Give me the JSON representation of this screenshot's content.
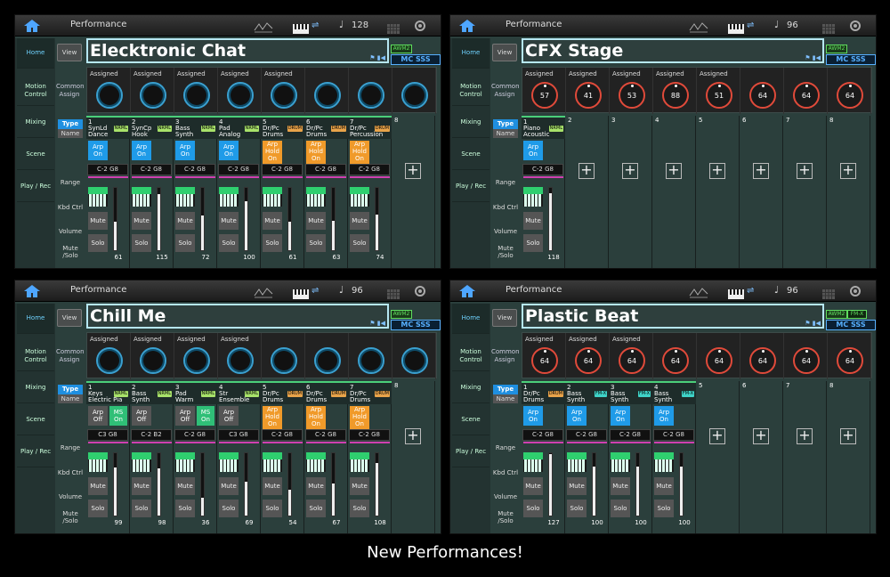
{
  "caption": "New Performances!",
  "top_bar": {
    "title": "Performance"
  },
  "sidebar": [
    "Home",
    "Motion Control",
    "Mixing",
    "Scene",
    "Play / Rec"
  ],
  "row_labels": {
    "common_assign": "Common Assign",
    "range": "Range",
    "kbd_ctrl": "Kbd Ctrl",
    "volume": "Volume",
    "mute_solo": "Mute /Solo"
  },
  "buttons": {
    "view": "View",
    "type": "Type",
    "name": "Name",
    "mute": "Mute",
    "solo": "Solo"
  },
  "screens": [
    {
      "tempo": "128",
      "name": "Elecktronic Chat",
      "badges": [
        "AWM2",
        "MC SSS"
      ],
      "knob_labels": [
        "Assigned",
        "Assigned",
        "Assigned",
        "Assigned",
        "Assigned",
        "",
        "",
        ""
      ],
      "knob_values": [
        "",
        "",
        "",
        "",
        "",
        "",
        "",
        ""
      ],
      "parts": [
        {
          "num": "1",
          "line1": "SynLd",
          "line2": "Dance",
          "tag": "NRML",
          "arp": [
            "Arp",
            "On"
          ],
          "range": "C-2  G8",
          "vol": "61",
          "fader": 0.45
        },
        {
          "num": "2",
          "line1": "SynCp",
          "line2": "Hook",
          "tag": "NRML",
          "arp": [
            "Arp",
            "On"
          ],
          "range": "C-2  G8",
          "vol": "115",
          "fader": 0.9
        },
        {
          "num": "3",
          "line1": "Bass",
          "line2": "Synth",
          "tag": "NRML",
          "arp": [
            "Arp",
            "On"
          ],
          "range": "C-2  G8",
          "vol": "72",
          "fader": 0.55
        },
        {
          "num": "4",
          "line1": "Pad",
          "line2": "Analog",
          "tag": "NRML",
          "arp": [
            "Arp",
            "On"
          ],
          "range": "C-2  G8",
          "vol": "100",
          "fader": 0.78
        },
        {
          "num": "5",
          "line1": "Dr/Pc",
          "line2": "Drums",
          "tag": "DRUM",
          "arp": [
            "Arp",
            "Hold",
            "On"
          ],
          "range": "C-2  G8",
          "vol": "61",
          "fader": 0.45
        },
        {
          "num": "6",
          "line1": "Dr/Pc",
          "line2": "Drums",
          "tag": "DRUM",
          "arp": [
            "Arp",
            "Hold",
            "On"
          ],
          "range": "C-2  G8",
          "vol": "63",
          "fader": 0.47
        },
        {
          "num": "7",
          "line1": "Dr/Pc",
          "line2": "Percussion",
          "tag": "DRUM",
          "arp": [
            "Arp",
            "Hold",
            "On"
          ],
          "range": "C-2  G8",
          "vol": "74",
          "fader": 0.57
        }
      ],
      "empty": [
        "8"
      ]
    },
    {
      "tempo": "96",
      "name": "CFX Stage",
      "badges": [
        "AWM2",
        "MC SSS"
      ],
      "knob_labels": [
        "Assigned",
        "Assigned",
        "Assigned",
        "Assigned",
        "Assigned",
        "",
        "",
        ""
      ],
      "knob_values": [
        "57",
        "41",
        "53",
        "88",
        "51",
        "64",
        "64",
        "64"
      ],
      "parts": [
        {
          "num": "1",
          "line1": "Piano",
          "line2": "Acoustic",
          "tag": "NRML",
          "arp": [
            "Arp",
            "On"
          ],
          "range": "C-2  G8",
          "vol": "118",
          "fader": 0.92
        }
      ],
      "empty": [
        "2",
        "3",
        "4",
        "5",
        "6",
        "7",
        "8"
      ]
    },
    {
      "tempo": "96",
      "name": "Chill Me",
      "badges": [
        "AWM2",
        "MC SSS"
      ],
      "knob_labels": [
        "Assigned",
        "Assigned",
        "Assigned",
        "Assigned",
        "",
        "",
        "",
        ""
      ],
      "knob_values": [
        "",
        "",
        "",
        "",
        "",
        "",
        "",
        ""
      ],
      "parts": [
        {
          "num": "1",
          "line1": "Keys",
          "line2": "Electric Pia",
          "tag": "NRML",
          "arp": [
            "Arp",
            "Off"
          ],
          "ms": [
            "MS",
            "On"
          ],
          "range": "C3  G8",
          "vol": "99",
          "fader": 0.77
        },
        {
          "num": "2",
          "line1": "Bass",
          "line2": "Synth",
          "tag": "NRML",
          "arp": [
            "Arp",
            "Off"
          ],
          "range": "C-2  B2",
          "vol": "98",
          "fader": 0.76
        },
        {
          "num": "3",
          "line1": "Pad",
          "line2": "Warm",
          "tag": "NRML",
          "arp": [
            "Arp",
            "Off"
          ],
          "ms": [
            "MS",
            "On"
          ],
          "range": "C-2  G8",
          "vol": "36",
          "fader": 0.28
        },
        {
          "num": "4",
          "line1": "Str",
          "line2": "Ensemble",
          "tag": "NRML",
          "arp": [
            "Arp",
            "Off"
          ],
          "range": "C3  G8",
          "vol": "69",
          "fader": 0.54
        },
        {
          "num": "5",
          "line1": "Dr/Pc",
          "line2": "Drums",
          "tag": "DRUM",
          "arp": [
            "Arp",
            "Hold",
            "On"
          ],
          "range": "C-2  G8",
          "vol": "54",
          "fader": 0.42
        },
        {
          "num": "6",
          "line1": "Dr/Pc",
          "line2": "Drums",
          "tag": "DRUM",
          "arp": [
            "Arp",
            "Hold",
            "On"
          ],
          "range": "C-2  G8",
          "vol": "67",
          "fader": 0.52
        },
        {
          "num": "7",
          "line1": "Dr/Pc",
          "line2": "Drums",
          "tag": "DRUM",
          "arp": [
            "Arp",
            "Hold",
            "On"
          ],
          "range": "C-2  G8",
          "vol": "108",
          "fader": 0.84
        }
      ],
      "empty": [
        "8"
      ]
    },
    {
      "tempo": "96",
      "name": "Plastic Beat",
      "badges": [
        "AWM2",
        "FM-X",
        "MC SSS"
      ],
      "knob_labels": [
        "Assigned",
        "Assigned",
        "Assigned",
        "",
        "",
        "",
        "",
        ""
      ],
      "knob_values": [
        "64",
        "64",
        "64",
        "64",
        "64",
        "64",
        "64",
        "64"
      ],
      "parts": [
        {
          "num": "1",
          "line1": "Dr/Pc",
          "line2": "Drums",
          "tag": "DRUM",
          "arp": [
            "Arp",
            "On"
          ],
          "range": "C-2  G8",
          "vol": "127",
          "fader": 0.99
        },
        {
          "num": "2",
          "line1": "Bass",
          "line2": "Synth",
          "tag": "FM-X",
          "arp": [
            "Arp",
            "On"
          ],
          "range": "C-2  G8",
          "vol": "100",
          "fader": 0.78
        },
        {
          "num": "3",
          "line1": "Bass",
          "line2": "Synth",
          "tag": "FM-X",
          "arp": [
            "Arp",
            "On"
          ],
          "range": "C-2  G8",
          "vol": "100",
          "fader": 0.78
        },
        {
          "num": "4",
          "line1": "Bass",
          "line2": "Synth",
          "tag": "FM-X",
          "arp": [
            "Arp",
            "On"
          ],
          "range": "C-2  G8",
          "vol": "100",
          "fader": 0.78
        }
      ],
      "empty": [
        "5",
        "6",
        "7",
        "8"
      ]
    }
  ]
}
